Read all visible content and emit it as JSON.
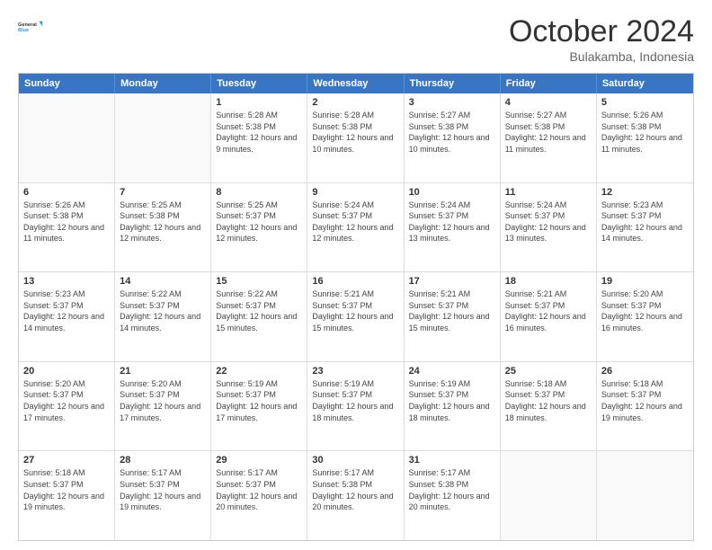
{
  "logo": {
    "line1": "General",
    "line2": "Blue"
  },
  "title": "October 2024",
  "subtitle": "Bulakamba, Indonesia",
  "days": [
    "Sunday",
    "Monday",
    "Tuesday",
    "Wednesday",
    "Thursday",
    "Friday",
    "Saturday"
  ],
  "weeks": [
    [
      {
        "day": "",
        "info": ""
      },
      {
        "day": "",
        "info": ""
      },
      {
        "day": "1",
        "info": "Sunrise: 5:28 AM\nSunset: 5:38 PM\nDaylight: 12 hours and 9 minutes."
      },
      {
        "day": "2",
        "info": "Sunrise: 5:28 AM\nSunset: 5:38 PM\nDaylight: 12 hours and 10 minutes."
      },
      {
        "day": "3",
        "info": "Sunrise: 5:27 AM\nSunset: 5:38 PM\nDaylight: 12 hours and 10 minutes."
      },
      {
        "day": "4",
        "info": "Sunrise: 5:27 AM\nSunset: 5:38 PM\nDaylight: 12 hours and 11 minutes."
      },
      {
        "day": "5",
        "info": "Sunrise: 5:26 AM\nSunset: 5:38 PM\nDaylight: 12 hours and 11 minutes."
      }
    ],
    [
      {
        "day": "6",
        "info": "Sunrise: 5:26 AM\nSunset: 5:38 PM\nDaylight: 12 hours and 11 minutes."
      },
      {
        "day": "7",
        "info": "Sunrise: 5:25 AM\nSunset: 5:38 PM\nDaylight: 12 hours and 12 minutes."
      },
      {
        "day": "8",
        "info": "Sunrise: 5:25 AM\nSunset: 5:37 PM\nDaylight: 12 hours and 12 minutes."
      },
      {
        "day": "9",
        "info": "Sunrise: 5:24 AM\nSunset: 5:37 PM\nDaylight: 12 hours and 12 minutes."
      },
      {
        "day": "10",
        "info": "Sunrise: 5:24 AM\nSunset: 5:37 PM\nDaylight: 12 hours and 13 minutes."
      },
      {
        "day": "11",
        "info": "Sunrise: 5:24 AM\nSunset: 5:37 PM\nDaylight: 12 hours and 13 minutes."
      },
      {
        "day": "12",
        "info": "Sunrise: 5:23 AM\nSunset: 5:37 PM\nDaylight: 12 hours and 14 minutes."
      }
    ],
    [
      {
        "day": "13",
        "info": "Sunrise: 5:23 AM\nSunset: 5:37 PM\nDaylight: 12 hours and 14 minutes."
      },
      {
        "day": "14",
        "info": "Sunrise: 5:22 AM\nSunset: 5:37 PM\nDaylight: 12 hours and 14 minutes."
      },
      {
        "day": "15",
        "info": "Sunrise: 5:22 AM\nSunset: 5:37 PM\nDaylight: 12 hours and 15 minutes."
      },
      {
        "day": "16",
        "info": "Sunrise: 5:21 AM\nSunset: 5:37 PM\nDaylight: 12 hours and 15 minutes."
      },
      {
        "day": "17",
        "info": "Sunrise: 5:21 AM\nSunset: 5:37 PM\nDaylight: 12 hours and 15 minutes."
      },
      {
        "day": "18",
        "info": "Sunrise: 5:21 AM\nSunset: 5:37 PM\nDaylight: 12 hours and 16 minutes."
      },
      {
        "day": "19",
        "info": "Sunrise: 5:20 AM\nSunset: 5:37 PM\nDaylight: 12 hours and 16 minutes."
      }
    ],
    [
      {
        "day": "20",
        "info": "Sunrise: 5:20 AM\nSunset: 5:37 PM\nDaylight: 12 hours and 17 minutes."
      },
      {
        "day": "21",
        "info": "Sunrise: 5:20 AM\nSunset: 5:37 PM\nDaylight: 12 hours and 17 minutes."
      },
      {
        "day": "22",
        "info": "Sunrise: 5:19 AM\nSunset: 5:37 PM\nDaylight: 12 hours and 17 minutes."
      },
      {
        "day": "23",
        "info": "Sunrise: 5:19 AM\nSunset: 5:37 PM\nDaylight: 12 hours and 18 minutes."
      },
      {
        "day": "24",
        "info": "Sunrise: 5:19 AM\nSunset: 5:37 PM\nDaylight: 12 hours and 18 minutes."
      },
      {
        "day": "25",
        "info": "Sunrise: 5:18 AM\nSunset: 5:37 PM\nDaylight: 12 hours and 18 minutes."
      },
      {
        "day": "26",
        "info": "Sunrise: 5:18 AM\nSunset: 5:37 PM\nDaylight: 12 hours and 19 minutes."
      }
    ],
    [
      {
        "day": "27",
        "info": "Sunrise: 5:18 AM\nSunset: 5:37 PM\nDaylight: 12 hours and 19 minutes."
      },
      {
        "day": "28",
        "info": "Sunrise: 5:17 AM\nSunset: 5:37 PM\nDaylight: 12 hours and 19 minutes."
      },
      {
        "day": "29",
        "info": "Sunrise: 5:17 AM\nSunset: 5:37 PM\nDaylight: 12 hours and 20 minutes."
      },
      {
        "day": "30",
        "info": "Sunrise: 5:17 AM\nSunset: 5:38 PM\nDaylight: 12 hours and 20 minutes."
      },
      {
        "day": "31",
        "info": "Sunrise: 5:17 AM\nSunset: 5:38 PM\nDaylight: 12 hours and 20 minutes."
      },
      {
        "day": "",
        "info": ""
      },
      {
        "day": "",
        "info": ""
      }
    ]
  ]
}
